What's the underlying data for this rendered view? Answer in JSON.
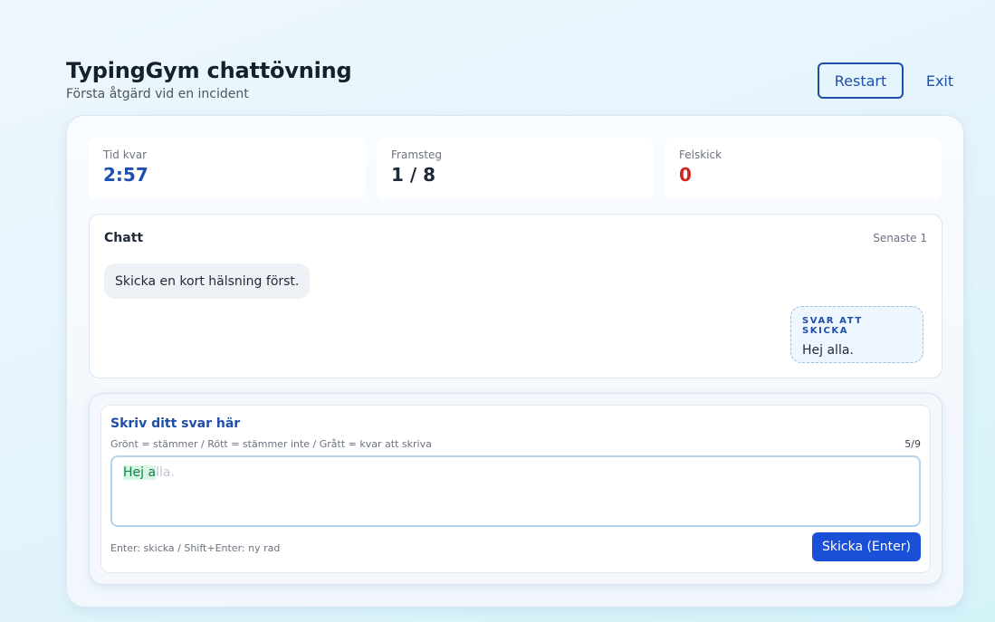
{
  "header": {
    "title": "TypingGym chattövning",
    "subtitle": "Första åtgärd vid en incident",
    "restart_label": "Restart",
    "exit_label": "Exit"
  },
  "stats": [
    {
      "label": "Tid kvar",
      "value": "2:57"
    },
    {
      "label": "Framsteg",
      "value": "1 / 8"
    },
    {
      "label": "Felskick",
      "value": "0"
    }
  ],
  "chat": {
    "title": "Chatt",
    "meta": "Senaste 1",
    "incoming_message": "Skicka en kort hälsning först.",
    "reply_label": "SVAR ATT SKICKA",
    "reply_text": "Hej alla."
  },
  "composer": {
    "title": "Skriv ditt svar här",
    "legend": "Grönt = stämmer / Rött = stämmer inte / Grått = kvar att skriva",
    "counter": "5/9",
    "typed_correct": "Hej a",
    "remaining": "lla.",
    "hint": "Enter: skicka / Shift+Enter: ny rad",
    "send_label": "Skicka (Enter)"
  },
  "colors": {
    "accent": "#1e4eaa",
    "send_button": "#1a4fd8",
    "error": "#d02525",
    "correct": "#14804a"
  }
}
